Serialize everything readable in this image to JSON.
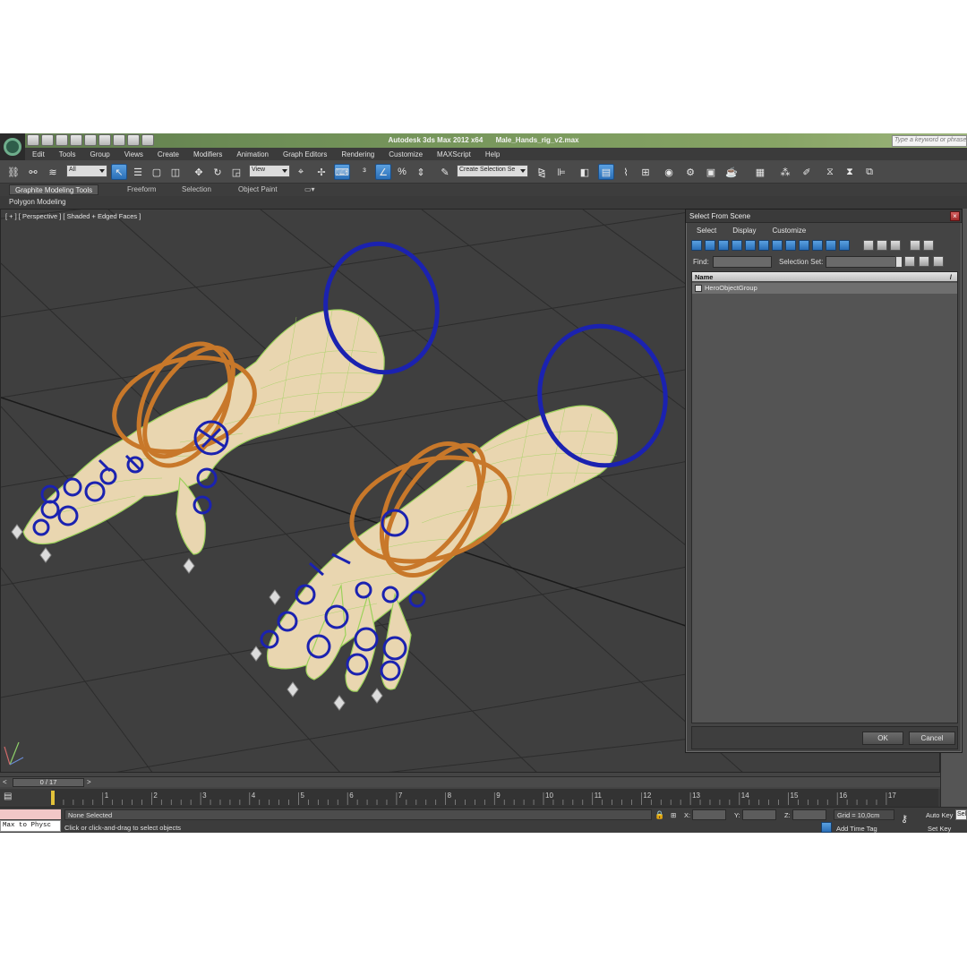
{
  "window": {
    "app_name": "Autodesk 3ds Max  2012 x64",
    "file_name": "Male_Hands_rig_v2.max",
    "search_placeholder": "Type a keyword or phrase"
  },
  "menu": [
    "Edit",
    "Tools",
    "Group",
    "Views",
    "Create",
    "Modifiers",
    "Animation",
    "Graph Editors",
    "Rendering",
    "Customize",
    "MAXScript",
    "Help"
  ],
  "toolbar": {
    "selection_filter": "All",
    "reference_coord": "View",
    "named_selection_set": "Create Selection Se"
  },
  "ribbon": {
    "tabs": [
      "Graphite Modeling Tools",
      "Freeform",
      "Selection",
      "Object Paint"
    ],
    "active_tab": "Graphite Modeling Tools",
    "panel_label": "Polygon Modeling"
  },
  "viewport": {
    "label": "[ + ] [ Perspective ] [ Shaded + Edged Faces ]"
  },
  "dialog": {
    "title": "Select From Scene",
    "close_label": "×",
    "menu": [
      "Select",
      "Display",
      "Customize"
    ],
    "find_label": "Find:",
    "find_value": "",
    "selection_set_label": "Selection Set:",
    "column_header": "Name",
    "sort_glyph": "/",
    "items": [
      "HeroObjectGroup"
    ],
    "ok_label": "OK",
    "cancel_label": "Cancel"
  },
  "timeline": {
    "frame_display": "0 / 17",
    "prev_glyph": "<",
    "next_glyph": ">",
    "ticks": [
      "1",
      "2",
      "3",
      "4",
      "5",
      "6",
      "7",
      "8",
      "9",
      "10",
      "11",
      "12",
      "13",
      "14",
      "15",
      "16",
      "17"
    ]
  },
  "status": {
    "maxscript_text": "Max to Physc",
    "selection": "None Selected",
    "prompt": "Click or click-and-drag to select objects",
    "x_label": "X:",
    "y_label": "Y:",
    "z_label": "Z:",
    "grid": "Grid = 10,0cm",
    "add_time_tag": "Add Time Tag",
    "auto_key": "Auto Key",
    "set_key": "Set Key",
    "selected_dd": "Selected"
  },
  "colors": {
    "rig_orange": "#c8782a",
    "rig_blue": "#1b22b0",
    "skin": "#e9d6b0",
    "wire": "#9bd25a",
    "accent_blue": "#2a6fb8"
  }
}
